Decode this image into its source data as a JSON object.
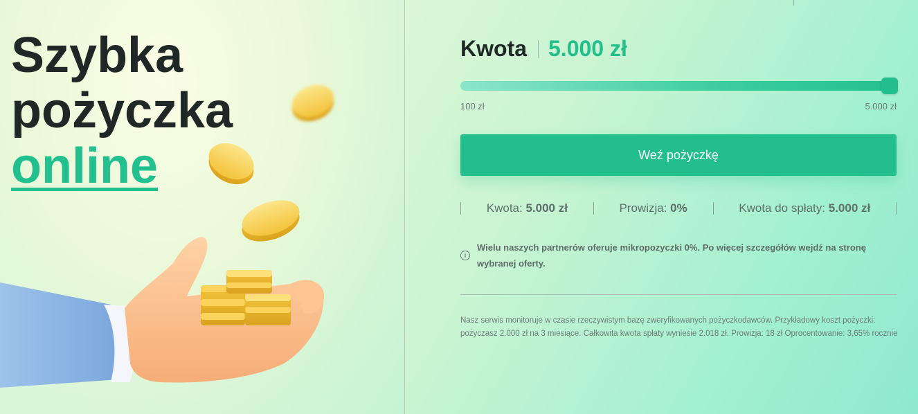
{
  "hero": {
    "line1": "Szybka",
    "line2": "pożyczka",
    "accent": "online"
  },
  "calculator": {
    "amount_label": "Kwota",
    "amount_value": "5.000 zł",
    "slider": {
      "min_label": "100 zł",
      "max_label": "5.000 zł",
      "fill_fraction": 1.0
    },
    "cta_label": "Weź pożyczkę",
    "summary": [
      {
        "label": "Kwota:",
        "value": "5.000 zł"
      },
      {
        "label": "Prowizja:",
        "value": "0%"
      },
      {
        "label": "Kwota do spłaty:",
        "value": "5.000 zł"
      }
    ],
    "info_icon": "info-circle-icon",
    "info_text": "Wielu naszych partnerów oferuje mikropozyczki 0%. Po więcej szczegółów wejdź na stronę wybranej oferty.",
    "footnote": "Nasz serwis monitoruje w czasie rzeczywistym bazę zweryfikowanych pożyczkodawców. Przykładowy koszt pożyczki: pożyczasz 2.000 zł na 3 miesiące. Całkowita kwota spłaty wyniesie 2.018 zł. Prowizja: 18 zł Oprocentowanie: 3,65% rocznie"
  },
  "colors": {
    "accent": "#22bf8c",
    "text_dark": "#1f2826"
  },
  "illustration": "hand-holding-coins"
}
